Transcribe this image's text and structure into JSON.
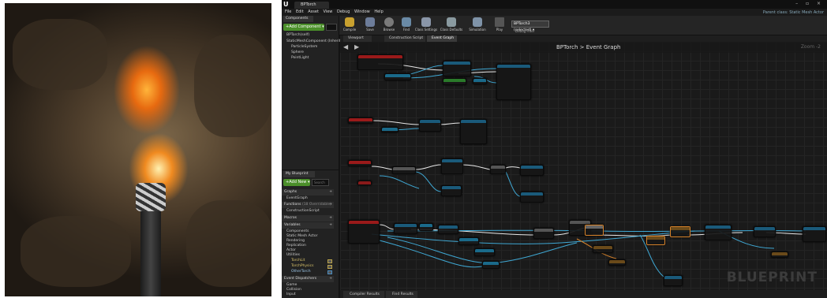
{
  "editor": {
    "document_tab": "BPTorch",
    "window_controls": "– ▫ ×",
    "parent_class": "Parent class: Static Mesh Actor",
    "menu": [
      "File",
      "Edit",
      "Asset",
      "View",
      "Debug",
      "Window",
      "Help"
    ],
    "toolbar": {
      "compile": "Compile",
      "save": "Save",
      "browse": "Browse",
      "find": "Find",
      "class_settings": "Class Settings",
      "class_defaults": "Class Defaults",
      "simulation": "Simulation",
      "play": "Play",
      "debug_selected": "BPTorch3 (selected) ▾",
      "debug_filter": "Debug Filter"
    },
    "components": {
      "tab": "Components",
      "add_button": "+Add Component ▾",
      "self": "BPTorch(self)",
      "root": "StaticMeshComponent (Inherited)",
      "children": [
        "ParticleSystem",
        "Sphere",
        "PointLight"
      ]
    },
    "my_blueprint": {
      "tab": "My Blueprint",
      "add_button": "+Add New ▾",
      "search_placeholder": "Search",
      "sections": {
        "graphs": "Graphs",
        "event_graph": "EventGraph",
        "functions": "Functions",
        "functions_note": "(18 Overridable)",
        "construction": "ConstructionScript",
        "macros": "Macros",
        "variables": "Variables",
        "dispatchers": "Event Dispatchers"
      },
      "variable_categories": [
        "Components",
        "Static Mesh Actor",
        "Rendering",
        "Replication",
        "Actor",
        "Utilities"
      ],
      "variables": [
        "TorchLit",
        "TorchPhysics",
        "OtherTorch"
      ],
      "dispatcher_items": [
        "Game",
        "Collision",
        "Input"
      ]
    },
    "graph": {
      "tabs": [
        "Viewport",
        "Construction Script",
        "Event Graph"
      ],
      "breadcrumb": "BPTorch  >  Event Graph",
      "zoom": "Zoom -2",
      "watermark": "BLUEPRINT"
    },
    "bottom_tabs": [
      "Compiler Results",
      "Find Results"
    ]
  }
}
